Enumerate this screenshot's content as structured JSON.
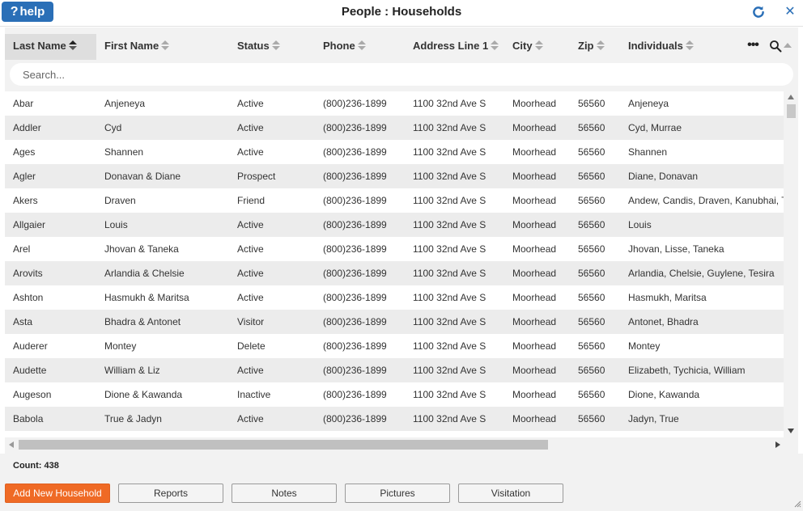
{
  "window": {
    "title": "People : Households",
    "help_label": "help",
    "help_glyph": "?",
    "accent_color": "#2a6fb7",
    "icons": {
      "refresh": "refresh-icon",
      "close": "close-icon"
    },
    "close_glyph": "✕"
  },
  "table": {
    "columns": [
      {
        "label": "Last Name",
        "sorted": true
      },
      {
        "label": "First Name"
      },
      {
        "label": "Status"
      },
      {
        "label": "Phone"
      },
      {
        "label": "Address Line 1"
      },
      {
        "label": "City"
      },
      {
        "label": "Zip"
      },
      {
        "label": "Individuals"
      }
    ],
    "more_glyph": "•••",
    "search_placeholder": "Search...",
    "rows": [
      [
        "Abar",
        "Anjeneya",
        "Active",
        "(800)236-1899",
        "1100 32nd Ave S",
        "Moorhead",
        "56560",
        "Anjeneya"
      ],
      [
        "Addler",
        "Cyd",
        "Active",
        "(800)236-1899",
        "1100 32nd Ave S",
        "Moorhead",
        "56560",
        "Cyd, Murrae"
      ],
      [
        "Ages",
        "Shannen",
        "Active",
        "(800)236-1899",
        "1100 32nd Ave S",
        "Moorhead",
        "56560",
        "Shannen"
      ],
      [
        "Agler",
        "Donavan & Diane",
        "Prospect",
        "(800)236-1899",
        "1100 32nd Ave S",
        "Moorhead",
        "56560",
        "Diane, Donavan"
      ],
      [
        "Akers",
        "Draven",
        "Friend",
        "(800)236-1899",
        "1100 32nd Ave S",
        "Moorhead",
        "56560",
        "Andew, Candis, Draven, Kanubhai, Te"
      ],
      [
        "Allgaier",
        "Louis",
        "Active",
        "(800)236-1899",
        "1100 32nd Ave S",
        "Moorhead",
        "56560",
        "Louis"
      ],
      [
        "Arel",
        "Jhovan & Taneka",
        "Active",
        "(800)236-1899",
        "1100 32nd Ave S",
        "Moorhead",
        "56560",
        "Jhovan, Lisse, Taneka"
      ],
      [
        "Arovits",
        "Arlandia & Chelsie",
        "Active",
        "(800)236-1899",
        "1100 32nd Ave S",
        "Moorhead",
        "56560",
        "Arlandia, Chelsie, Guylene, Tesira"
      ],
      [
        "Ashton",
        "Hasmukh & Maritsa",
        "Active",
        "(800)236-1899",
        "1100 32nd Ave S",
        "Moorhead",
        "56560",
        "Hasmukh, Maritsa"
      ],
      [
        "Asta",
        "Bhadra & Antonet",
        "Visitor",
        "(800)236-1899",
        "1100 32nd Ave S",
        "Moorhead",
        "56560",
        "Antonet, Bhadra"
      ],
      [
        "Auderer",
        "Montey",
        "Delete",
        "(800)236-1899",
        "1100 32nd Ave S",
        "Moorhead",
        "56560",
        "Montey"
      ],
      [
        "Audette",
        "William & Liz",
        "Active",
        "(800)236-1899",
        "1100 32nd Ave S",
        "Moorhead",
        "56560",
        "Elizabeth, Tychicia, William"
      ],
      [
        "Augeson",
        "Dione & Kawanda",
        "Inactive",
        "(800)236-1899",
        "1100 32nd Ave S",
        "Moorhead",
        "56560",
        "Dione, Kawanda"
      ],
      [
        "Babola",
        "True & Jadyn",
        "Active",
        "(800)236-1899",
        "1100 32nd Ave S",
        "Moorhead",
        "56560",
        "Jadyn, True"
      ]
    ]
  },
  "footer": {
    "count_label": "Count: 438",
    "buttons": {
      "add": "Add New Household",
      "reports": "Reports",
      "notes": "Notes",
      "pictures": "Pictures",
      "visitation": "Visitation"
    },
    "primary_color": "#ef6a25"
  }
}
